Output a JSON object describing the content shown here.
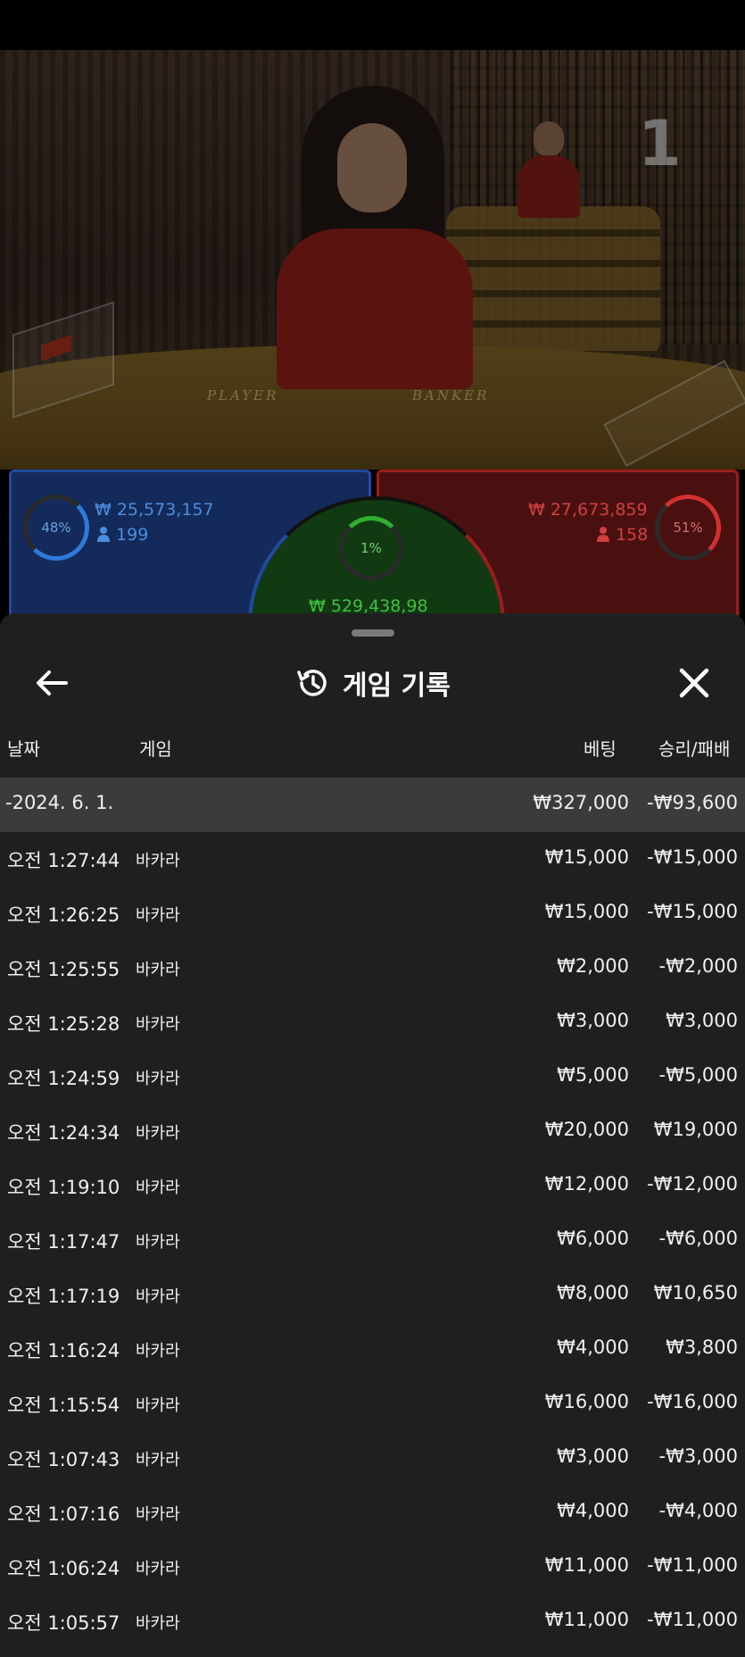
{
  "round_number": "1",
  "table_labels": {
    "player": "PLAYER",
    "banker": "BANKER"
  },
  "betting": {
    "player": {
      "percent": "48%",
      "amount": "₩ 25,573,157",
      "players": "199"
    },
    "banker": {
      "percent": "51%",
      "amount": "₩ 27,673,859",
      "players": "158"
    },
    "tie": {
      "percent": "1%",
      "amount": "₩ 529,438,98"
    }
  },
  "history": {
    "title": "게임 기록",
    "columns": {
      "date": "날짜",
      "game": "게임",
      "bet": "베팅",
      "result": "승리/패배"
    },
    "summary": {
      "date": "-2024. 6. 1.",
      "bet": "₩327,000",
      "result": "-₩93,600"
    },
    "rows": [
      {
        "time": "오전 1:27:44",
        "game": "바카라",
        "bet": "₩15,000",
        "result": "-₩15,000"
      },
      {
        "time": "오전 1:26:25",
        "game": "바카라",
        "bet": "₩15,000",
        "result": "-₩15,000"
      },
      {
        "time": "오전 1:25:55",
        "game": "바카라",
        "bet": "₩2,000",
        "result": "-₩2,000"
      },
      {
        "time": "오전 1:25:28",
        "game": "바카라",
        "bet": "₩3,000",
        "result": "₩3,000"
      },
      {
        "time": "오전 1:24:59",
        "game": "바카라",
        "bet": "₩5,000",
        "result": "-₩5,000"
      },
      {
        "time": "오전 1:24:34",
        "game": "바카라",
        "bet": "₩20,000",
        "result": "₩19,000"
      },
      {
        "time": "오전 1:19:10",
        "game": "바카라",
        "bet": "₩12,000",
        "result": "-₩12,000"
      },
      {
        "time": "오전 1:17:47",
        "game": "바카라",
        "bet": "₩6,000",
        "result": "-₩6,000"
      },
      {
        "time": "오전 1:17:19",
        "game": "바카라",
        "bet": "₩8,000",
        "result": "₩10,650"
      },
      {
        "time": "오전 1:16:24",
        "game": "바카라",
        "bet": "₩4,000",
        "result": "₩3,800"
      },
      {
        "time": "오전 1:15:54",
        "game": "바카라",
        "bet": "₩16,000",
        "result": "-₩16,000"
      },
      {
        "time": "오전 1:07:43",
        "game": "바카라",
        "bet": "₩3,000",
        "result": "-₩3,000"
      },
      {
        "time": "오전 1:07:16",
        "game": "바카라",
        "bet": "₩4,000",
        "result": "-₩4,000"
      },
      {
        "time": "오전 1:06:24",
        "game": "바카라",
        "bet": "₩11,000",
        "result": "-₩11,000"
      },
      {
        "time": "오전 1:05:57",
        "game": "바카라",
        "bet": "₩11,000",
        "result": "-₩11,000"
      }
    ]
  },
  "icons": {
    "back": "arrow-left-icon",
    "history": "history-clock-icon",
    "close": "close-icon",
    "person": "person-icon"
  },
  "colors": {
    "player": "#1f4aa0",
    "banker": "#9a1e1e",
    "tie": "#2fb030",
    "sheet": "#1f1f1f",
    "summary_row": "#3b3b3b"
  }
}
